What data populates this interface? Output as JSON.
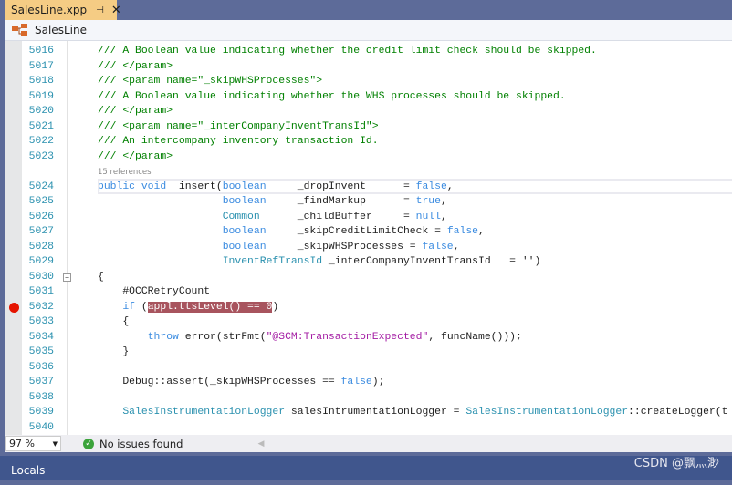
{
  "tab": {
    "title": "SalesLine.xpp",
    "pin_icon": "pin-icon",
    "close_icon": "close-icon"
  },
  "navbar": {
    "label": "SalesLine",
    "icon": "class-hierarchy-icon"
  },
  "editor": {
    "code_lens": "15 references",
    "lines": [
      {
        "n": "5016",
        "t": [
          [
            "comment",
            "/// A Boolean value indicating whether the credit limit check should be skipped."
          ]
        ]
      },
      {
        "n": "5017",
        "t": [
          [
            "comment",
            "/// </param>"
          ]
        ]
      },
      {
        "n": "5018",
        "t": [
          [
            "comment",
            "/// <param name=\"_skipWHSProcesses\">"
          ]
        ]
      },
      {
        "n": "5019",
        "t": [
          [
            "comment",
            "/// A Boolean value indicating whether the WHS processes should be skipped."
          ]
        ]
      },
      {
        "n": "5020",
        "t": [
          [
            "comment",
            "/// </param>"
          ]
        ]
      },
      {
        "n": "5021",
        "t": [
          [
            "comment",
            "/// <param name=\"_interCompanyInventTransId\">"
          ]
        ]
      },
      {
        "n": "5022",
        "t": [
          [
            "comment",
            "/// An intercompany inventory transaction Id."
          ]
        ]
      },
      {
        "n": "5023",
        "t": [
          [
            "comment",
            "/// </param>"
          ]
        ]
      },
      {
        "n": "5024",
        "t": [
          [
            "kw",
            "public void"
          ],
          [
            "plain",
            "  insert("
          ],
          [
            "kw",
            "boolean"
          ],
          [
            "plain",
            "     _dropInvent      = "
          ],
          [
            "kw",
            "false"
          ],
          [
            "plain",
            ","
          ]
        ]
      },
      {
        "n": "5025",
        "t": [
          [
            "plain",
            "                    "
          ],
          [
            "kw",
            "boolean"
          ],
          [
            "plain",
            "     _findMarkup      = "
          ],
          [
            "kw",
            "true"
          ],
          [
            "plain",
            ","
          ]
        ]
      },
      {
        "n": "5026",
        "t": [
          [
            "plain",
            "                    "
          ],
          [
            "type",
            "Common"
          ],
          [
            "plain",
            "      _childBuffer     = "
          ],
          [
            "kw",
            "null"
          ],
          [
            "plain",
            ","
          ]
        ]
      },
      {
        "n": "5027",
        "t": [
          [
            "plain",
            "                    "
          ],
          [
            "kw",
            "boolean"
          ],
          [
            "plain",
            "     _skipCreditLimitCheck = "
          ],
          [
            "kw",
            "false"
          ],
          [
            "plain",
            ","
          ]
        ]
      },
      {
        "n": "5028",
        "t": [
          [
            "plain",
            "                    "
          ],
          [
            "kw",
            "boolean"
          ],
          [
            "plain",
            "     _skipWHSProcesses = "
          ],
          [
            "kw",
            "false"
          ],
          [
            "plain",
            ","
          ]
        ]
      },
      {
        "n": "5029",
        "t": [
          [
            "plain",
            "                    "
          ],
          [
            "type",
            "InventRefTransId"
          ],
          [
            "plain",
            " _interCompanyInventTransId   = '')"
          ]
        ]
      },
      {
        "n": "5030",
        "t": [
          [
            "plain",
            "{"
          ]
        ]
      },
      {
        "n": "5031",
        "t": [
          [
            "plain",
            "    #OCCRetryCount"
          ]
        ]
      },
      {
        "n": "5032",
        "t": [
          [
            "plain",
            "    "
          ],
          [
            "kw",
            "if"
          ],
          [
            "plain",
            " ("
          ],
          [
            "hl",
            "appl.ttsLevel() == 0"
          ],
          [
            "plain",
            ")"
          ]
        ]
      },
      {
        "n": "5033",
        "t": [
          [
            "plain",
            "    {"
          ]
        ]
      },
      {
        "n": "5034",
        "t": [
          [
            "plain",
            "        "
          ],
          [
            "kw",
            "throw"
          ],
          [
            "plain",
            " error(strFmt("
          ],
          [
            "str",
            "\"@SCM:TransactionExpected\""
          ],
          [
            "plain",
            ", funcName()));"
          ]
        ]
      },
      {
        "n": "5035",
        "t": [
          [
            "plain",
            "    }"
          ]
        ]
      },
      {
        "n": "5036",
        "t": []
      },
      {
        "n": "5037",
        "t": [
          [
            "plain",
            "    Debug::assert(_skipWHSProcesses == "
          ],
          [
            "kw",
            "false"
          ],
          [
            "plain",
            ");"
          ]
        ]
      },
      {
        "n": "5038",
        "t": []
      },
      {
        "n": "5039",
        "t": [
          [
            "plain",
            "    "
          ],
          [
            "type",
            "SalesInstrumentationLogger"
          ],
          [
            "plain",
            " salesIntrumentationLogger = "
          ],
          [
            "type",
            "SalesInstrumentationLogger"
          ],
          [
            "plain",
            "::createLogger(t"
          ]
        ]
      },
      {
        "n": "5040",
        "t": []
      }
    ],
    "breakpoint_line": "5032",
    "current_line": "5024",
    "fold_line": "5030"
  },
  "status": {
    "zoom": "97 %",
    "issues": "No issues found"
  },
  "panel": {
    "title": "Locals"
  },
  "watermark": "CSDN @飘灬渺",
  "colors": {
    "tab_active": "#f5cc84",
    "chrome": "#5d6b99",
    "panel": "#40568d",
    "comment": "#008000",
    "keyword": "#3a8be0",
    "type": "#2b91af",
    "string": "#a31ba3",
    "breakpoint": "#e51400"
  }
}
